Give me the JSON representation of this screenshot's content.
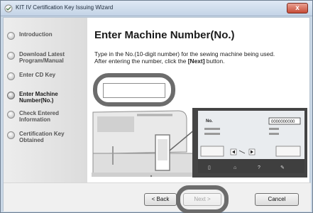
{
  "window": {
    "title": "KIT IV Certification Key Issuing Wizard",
    "close_label": "x"
  },
  "sidebar": {
    "items": [
      {
        "label": "Introduction",
        "active": false
      },
      {
        "label": "Download Latest Program/Manual",
        "active": false
      },
      {
        "label": "Enter CD Key",
        "active": false
      },
      {
        "label": "Enter Machine Number(No.)",
        "active": true
      },
      {
        "label": "Check Entered Information",
        "active": false
      },
      {
        "label": "Certification Key Obtained",
        "active": false
      }
    ]
  },
  "main": {
    "heading": "Enter Machine Number(No.)",
    "instruction_line1": "Type in the No.(10-digit number) for the sewing machine being used.",
    "instruction_line2_prefix": "After entering the number, click the ",
    "instruction_line2_bold": "[Next]",
    "instruction_line2_suffix": " button.",
    "machine_number_value": "",
    "machine_number_placeholder": ""
  },
  "illustration": {
    "screen_no_label": "No.",
    "screen_no_value": "0000000000"
  },
  "footer": {
    "back_label": "< Back",
    "next_label": "Next >",
    "cancel_label": "Cancel"
  },
  "colors": {
    "ring": "#6c6c6c",
    "window_frame": "#c9d7e6"
  }
}
